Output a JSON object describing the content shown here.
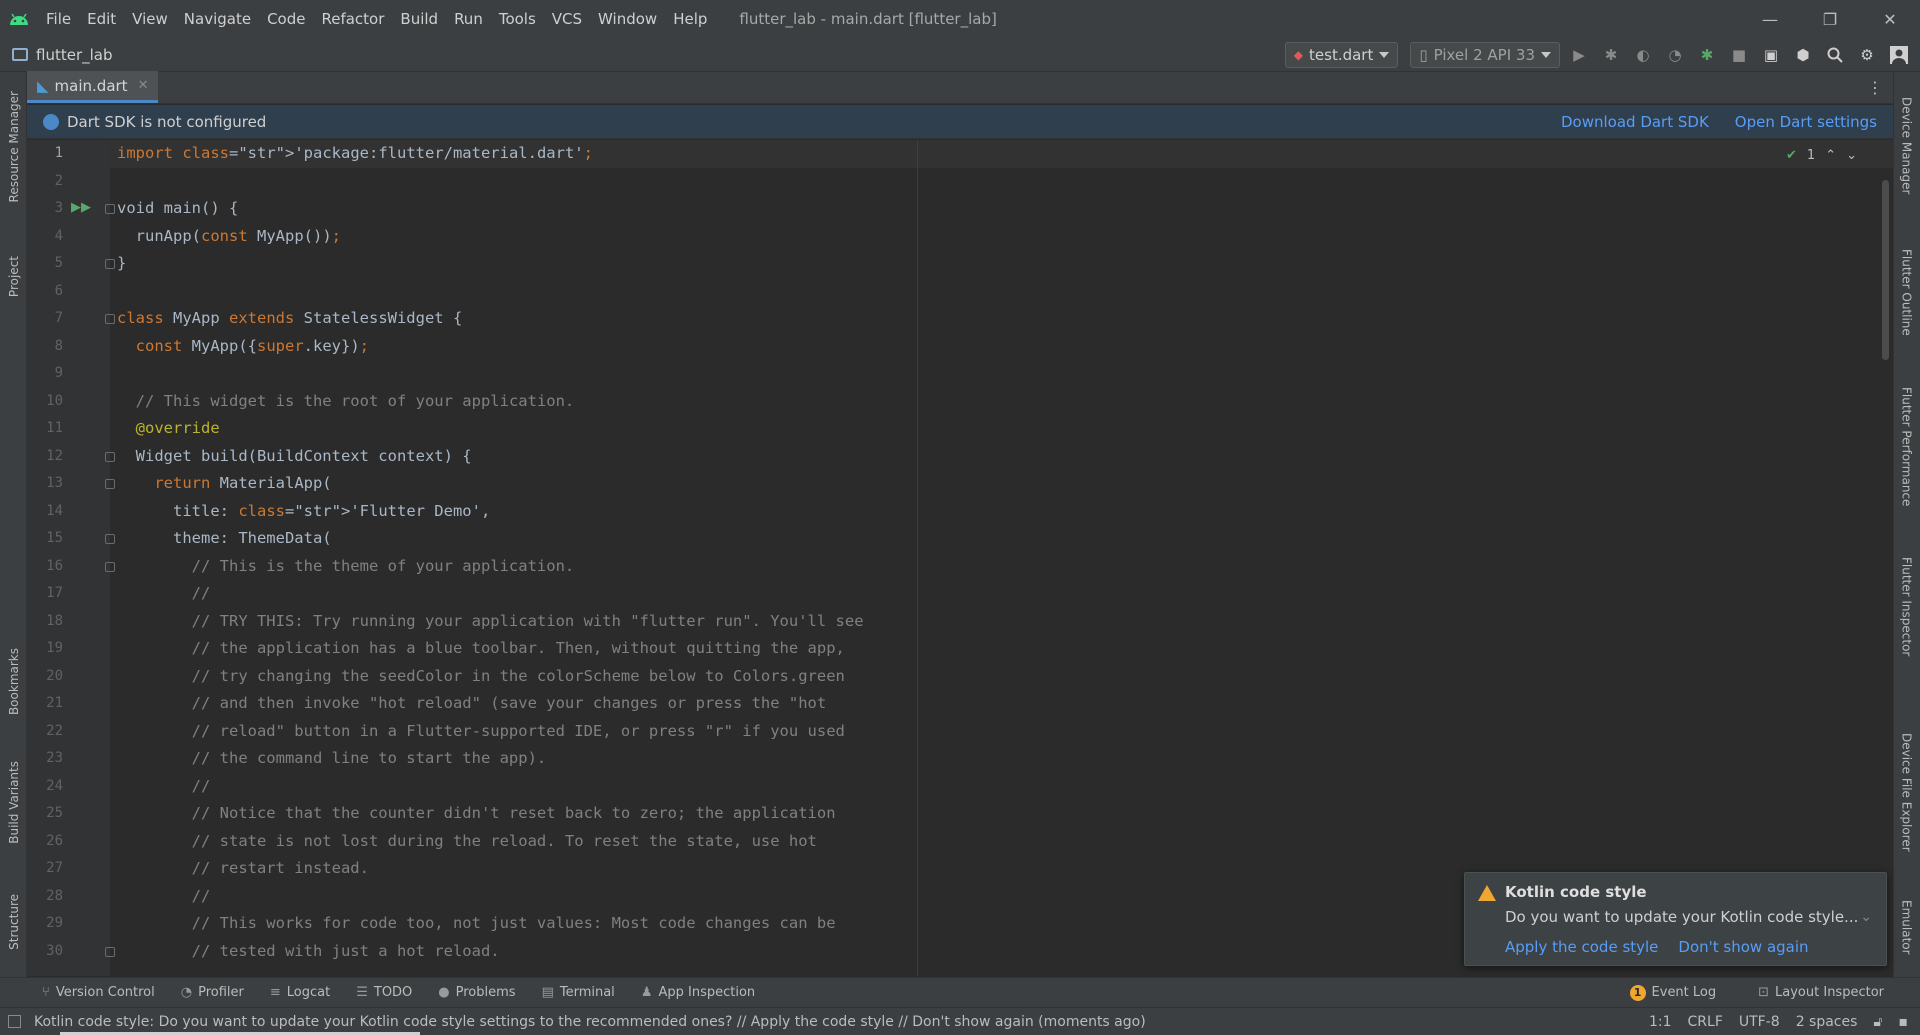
{
  "window": {
    "title": "flutter_lab - main.dart [flutter_lab]",
    "controls": {
      "minimize": "—",
      "restore": "❐",
      "close": "✕"
    }
  },
  "menu": [
    "File",
    "Edit",
    "View",
    "Navigate",
    "Code",
    "Refactor",
    "Build",
    "Run",
    "Tools",
    "VCS",
    "Window",
    "Help"
  ],
  "navbar": {
    "project": "flutter_lab",
    "run_config": "test.dart",
    "device": "Pixel 2 API 33"
  },
  "left_tools": [
    "Resource Manager",
    "Project",
    "Bookmarks",
    "Build Variants",
    "Structure"
  ],
  "right_tools": [
    "Device Manager",
    "Flutter Outline",
    "Flutter Performance",
    "Flutter Inspector",
    "Device File Explorer",
    "Emulator"
  ],
  "tab": {
    "label": "main.dart"
  },
  "banner": {
    "message": "Dart SDK is not configured",
    "link1": "Download Dart SDK",
    "link2": "Open Dart settings"
  },
  "inspections": {
    "count": "1"
  },
  "code": [
    {
      "n": "1",
      "text": "import 'package:flutter/material.dart';"
    },
    {
      "n": "2",
      "text": ""
    },
    {
      "n": "3",
      "text": "void main() {"
    },
    {
      "n": "4",
      "text": "  runApp(const MyApp());"
    },
    {
      "n": "5",
      "text": "}"
    },
    {
      "n": "6",
      "text": ""
    },
    {
      "n": "7",
      "text": "class MyApp extends StatelessWidget {"
    },
    {
      "n": "8",
      "text": "  const MyApp({super.key});"
    },
    {
      "n": "9",
      "text": ""
    },
    {
      "n": "10",
      "text": "  // This widget is the root of your application."
    },
    {
      "n": "11",
      "text": "  @override"
    },
    {
      "n": "12",
      "text": "  Widget build(BuildContext context) {"
    },
    {
      "n": "13",
      "text": "    return MaterialApp("
    },
    {
      "n": "14",
      "text": "      title: 'Flutter Demo',"
    },
    {
      "n": "15",
      "text": "      theme: ThemeData("
    },
    {
      "n": "16",
      "text": "        // This is the theme of your application."
    },
    {
      "n": "17",
      "text": "        //"
    },
    {
      "n": "18",
      "text": "        // TRY THIS: Try running your application with \"flutter run\". You'll see"
    },
    {
      "n": "19",
      "text": "        // the application has a blue toolbar. Then, without quitting the app,"
    },
    {
      "n": "20",
      "text": "        // try changing the seedColor in the colorScheme below to Colors.green"
    },
    {
      "n": "21",
      "text": "        // and then invoke \"hot reload\" (save your changes or press the \"hot"
    },
    {
      "n": "22",
      "text": "        // reload\" button in a Flutter-supported IDE, or press \"r\" if you used"
    },
    {
      "n": "23",
      "text": "        // the command line to start the app)."
    },
    {
      "n": "24",
      "text": "        //"
    },
    {
      "n": "25",
      "text": "        // Notice that the counter didn't reset back to zero; the application"
    },
    {
      "n": "26",
      "text": "        // state is not lost during the reload. To reset the state, use hot"
    },
    {
      "n": "27",
      "text": "        // restart instead."
    },
    {
      "n": "28",
      "text": "        //"
    },
    {
      "n": "29",
      "text": "        // This works for code too, not just values: Most code changes can be"
    },
    {
      "n": "30",
      "text": "        // tested with just a hot reload."
    }
  ],
  "notification": {
    "title": "Kotlin code style",
    "body": "Do you want to update your Kotlin code style...",
    "action1": "Apply the code style",
    "action2": "Don't show again"
  },
  "bottom_tools": [
    "Version Control",
    "Profiler",
    "Logcat",
    "TODO",
    "Problems",
    "Terminal",
    "App Inspection"
  ],
  "bottom_right": {
    "event_log": "Event Log",
    "event_count": "1",
    "layout_inspector": "Layout Inspector"
  },
  "status": {
    "message": "Kotlin code style: Do you want to update your Kotlin code style settings to the recommended ones? // Apply the code style // Don't show again (moments ago)",
    "position": "1:1",
    "line_sep": "CRLF",
    "encoding": "UTF-8",
    "indent": "2 spaces"
  },
  "colors": {
    "accent": "#4a88c7",
    "link": "#589df6",
    "warning": "#f0a732",
    "run": "#59a869"
  }
}
